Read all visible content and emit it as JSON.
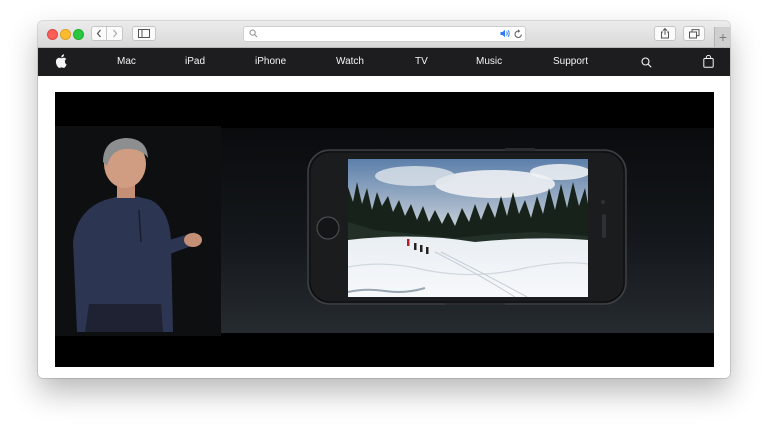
{
  "nav": {
    "items": [
      {
        "label": "Mac"
      },
      {
        "label": "iPad"
      },
      {
        "label": "iPhone"
      },
      {
        "label": "Watch"
      },
      {
        "label": "TV"
      },
      {
        "label": "Music"
      },
      {
        "label": "Support"
      }
    ],
    "icons": [
      "apple-logo-icon",
      "search-icon",
      "bag-icon"
    ]
  },
  "toolbar": {
    "icons": [
      "chevron-left-icon",
      "chevron-right-icon",
      "sidebar-icon",
      "search-icon",
      "speaker-icon",
      "reload-icon",
      "share-icon",
      "tabs-icon",
      "plus-icon"
    ],
    "new_tab_symbol": "+"
  },
  "colors": {
    "navbar": "#1d1d1f",
    "speaker_accent": "#2f7bf5",
    "close": "#fc5f57",
    "minimize": "#fdbc2e",
    "zoom": "#28c840"
  }
}
